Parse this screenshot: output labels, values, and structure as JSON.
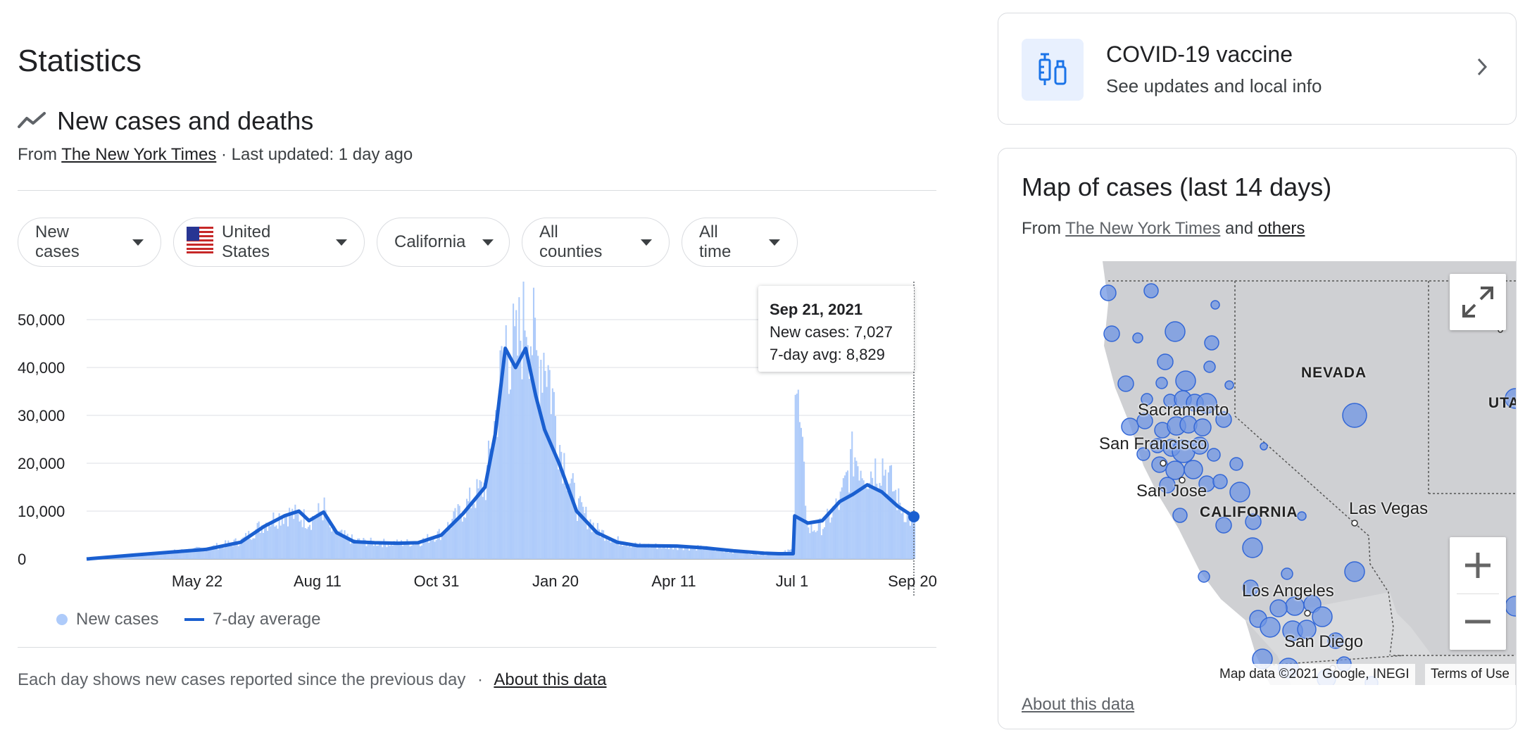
{
  "page": {
    "title": "Statistics",
    "section_heading": "New cases and deaths",
    "source_prefix": "From",
    "source_name": "The New York Times",
    "last_updated": "· Last updated: 1 day ago",
    "filters": [
      {
        "label": "New cases"
      },
      {
        "label": "United States"
      },
      {
        "label": "California"
      },
      {
        "label": "All counties"
      },
      {
        "label": "All time"
      }
    ],
    "footer_text": "Each day shows new cases reported since the previous day",
    "footer_sep": "·",
    "footer_link": "About this data"
  },
  "tooltip": {
    "date": "Sep 21, 2021",
    "new_cases": "New cases: 7,027",
    "avg": "7-day avg: 8,829"
  },
  "colors": {
    "bar": "#aecbfa",
    "line": "#1a5fd0",
    "grid": "#e8eaed"
  },
  "chart_data": {
    "type": "bar",
    "title": "",
    "xlabel": "",
    "ylabel": "",
    "ylim": [
      0,
      57000
    ],
    "yticks": [
      "0",
      "10,000",
      "20,000",
      "30,000",
      "40,000",
      "50,000"
    ],
    "xticks": [
      "May 22",
      "Aug 11",
      "Oct 31",
      "Jan 20",
      "Apr 11",
      "Jul 1",
      "Sep 20"
    ],
    "x_range": [
      "2020-03-01",
      "2021-09-21"
    ],
    "series": [
      {
        "name": "New cases",
        "kind": "bar",
        "x": [
          "2020-03-01",
          "2020-04-01",
          "2020-05-01",
          "2020-05-22",
          "2020-06-15",
          "2020-07-01",
          "2020-07-15",
          "2020-07-25",
          "2020-08-01",
          "2020-08-11",
          "2020-08-15",
          "2020-09-01",
          "2020-09-15",
          "2020-10-01",
          "2020-10-15",
          "2020-10-31",
          "2020-11-15",
          "2020-11-30",
          "2020-12-07",
          "2020-12-14",
          "2020-12-21",
          "2020-12-28",
          "2021-01-04",
          "2021-01-10",
          "2021-01-20",
          "2021-02-01",
          "2021-02-15",
          "2021-03-01",
          "2021-03-15",
          "2021-04-11",
          "2021-05-01",
          "2021-05-20",
          "2021-06-10",
          "2021-06-20",
          "2021-06-30",
          "2021-07-01",
          "2021-07-10",
          "2021-07-20",
          "2021-08-01",
          "2021-08-10",
          "2021-08-20",
          "2021-08-30",
          "2021-09-10",
          "2021-09-21"
        ],
        "values": [
          0,
          900,
          1600,
          2200,
          3800,
          7500,
          9500,
          9000,
          8000,
          10500,
          6000,
          3800,
          3400,
          3300,
          3500,
          5500,
          10500,
          15500,
          30000,
          46000,
          42000,
          54000,
          41000,
          44000,
          24000,
          11000,
          6000,
          3800,
          2800,
          2600,
          2200,
          1600,
          1000,
          1100,
          2000,
          38000,
          6000,
          7000,
          12000,
          22000,
          18000,
          20000,
          12000,
          7027
        ]
      },
      {
        "name": "7-day average",
        "kind": "line",
        "x": [
          "2020-03-01",
          "2020-04-01",
          "2020-05-01",
          "2020-05-22",
          "2020-06-15",
          "2020-07-01",
          "2020-07-15",
          "2020-07-25",
          "2020-08-01",
          "2020-08-11",
          "2020-08-20",
          "2020-09-01",
          "2020-09-15",
          "2020-10-01",
          "2020-10-15",
          "2020-10-31",
          "2020-11-15",
          "2020-11-30",
          "2020-12-07",
          "2020-12-14",
          "2020-12-21",
          "2020-12-28",
          "2021-01-04",
          "2021-01-10",
          "2021-01-20",
          "2021-02-01",
          "2021-02-15",
          "2021-03-01",
          "2021-03-15",
          "2021-04-11",
          "2021-05-01",
          "2021-05-20",
          "2021-06-10",
          "2021-06-20",
          "2021-06-30",
          "2021-07-01",
          "2021-07-10",
          "2021-07-20",
          "2021-08-01",
          "2021-08-10",
          "2021-08-20",
          "2021-08-30",
          "2021-09-10",
          "2021-09-21"
        ],
        "values": [
          0,
          800,
          1500,
          2000,
          3500,
          6800,
          9000,
          10000,
          8000,
          9800,
          5500,
          3600,
          3400,
          3300,
          3400,
          5000,
          9500,
          15000,
          26000,
          44000,
          40000,
          44000,
          34000,
          27000,
          20000,
          10000,
          5500,
          3500,
          2800,
          2700,
          2300,
          1700,
          1200,
          1100,
          1100,
          9000,
          7500,
          8000,
          12000,
          13500,
          15500,
          14000,
          11000,
          8829
        ]
      }
    ],
    "legend": "bottom-left",
    "grid": true
  },
  "map": {
    "title": "Map of cases (last 14 days)",
    "source_prefix": "From",
    "source_name": "The New York Times",
    "and_text": "and",
    "others_text": "others",
    "labels": {
      "nevada": "NEVADA",
      "california": "CALIFORNIA",
      "utah": "UTA",
      "sacramento": "Sacramento",
      "san_francisco": "San Francisco",
      "san_jose": "San Jose",
      "las_vegas": "Las Vegas",
      "los_angeles": "Los Angeles",
      "san_diego": "San Diego"
    },
    "attribution": "Map data ©2021 Google, INEGI",
    "terms": "Terms of Use",
    "about": "About this data"
  },
  "vaccine": {
    "title": "COVID-19 vaccine",
    "subtitle": "See updates and local info"
  }
}
